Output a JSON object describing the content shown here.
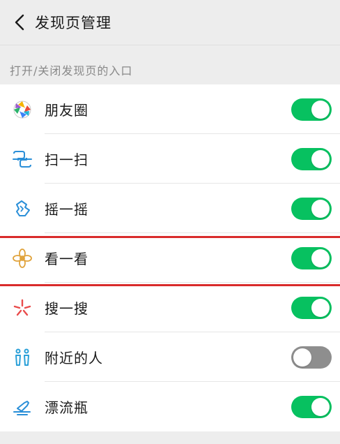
{
  "header": {
    "title": "发现页管理"
  },
  "section": {
    "label": "打开/关闭发现页的入口"
  },
  "items": [
    {
      "label": "朋友圈",
      "icon": "moments-icon",
      "enabled": true
    },
    {
      "label": "扫一扫",
      "icon": "scan-icon",
      "enabled": true
    },
    {
      "label": "摇一摇",
      "icon": "shake-icon",
      "enabled": true
    },
    {
      "label": "看一看",
      "icon": "top-stories-icon",
      "enabled": true
    },
    {
      "label": "搜一搜",
      "icon": "search-icon",
      "enabled": true
    },
    {
      "label": "附近的人",
      "icon": "people-nearby-icon",
      "enabled": false
    },
    {
      "label": "漂流瓶",
      "icon": "drift-bottle-icon",
      "enabled": true
    }
  ],
  "colors": {
    "toggle_on": "#07c160",
    "toggle_off": "#8e8e8e",
    "highlight": "#d92b2b"
  }
}
